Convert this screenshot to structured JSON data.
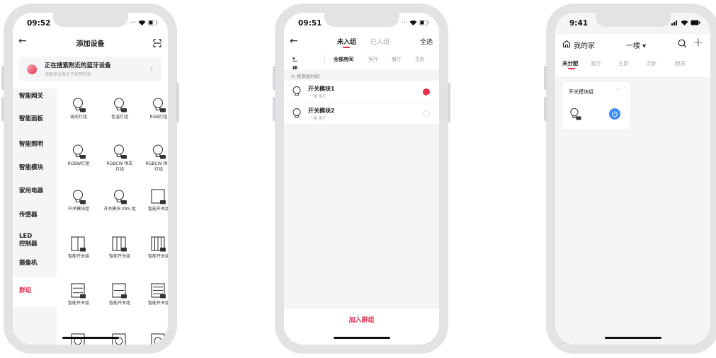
{
  "phone1": {
    "status_time": "09:52",
    "title": "添加设备",
    "bluetooth": {
      "title": "正在搜索附近的蓝牙设备",
      "subtitle": "请确保设备处于配网状态"
    },
    "categories": [
      "智能网关",
      "智能面板",
      "智能照明",
      "智能模块",
      "家用电器",
      "传感器",
      "LED\n控制器",
      "摄像机",
      "群组"
    ],
    "active_category": "群组",
    "grid": [
      "调光灯组",
      "色温灯组",
      "RGB灯组",
      "RGBW灯组",
      "RGBCW 恒压\n灯组",
      "RGBCW 恒流\n灯组",
      "开关模块组",
      "开关模块 KBS 组",
      "智能开关组",
      "智能开关组",
      "智能开关组",
      "智能开关组",
      "智能开关组",
      "智能开关组",
      "智能开关组"
    ]
  },
  "phone2": {
    "status_time": "09:51",
    "tabs": [
      "未入组",
      "已入组"
    ],
    "select_all": "全选",
    "floor_filter": "一楼",
    "room_filters": [
      "全部房间",
      "客厅",
      "餐厅",
      "主卧"
    ],
    "sort_hint": "按添加时间",
    "devices": [
      {
        "name": "开关模块1",
        "room": "一楼 客厅",
        "selected": true
      },
      {
        "name": "开关模块2",
        "room": "一楼 客厅",
        "selected": false
      }
    ],
    "join_button": "加入群组"
  },
  "phone3": {
    "status_time": "9:41",
    "home_name": "我的家",
    "floor": "一楼",
    "room_tabs": [
      "未分配",
      "客厅",
      "主卧",
      "次卧",
      "厨房"
    ],
    "group_card": {
      "name": "开关模块组",
      "more": "···"
    }
  },
  "colors": {
    "accent": "#e62e4a",
    "power": "#3d8bf5",
    "background": "#f5f5f7"
  }
}
